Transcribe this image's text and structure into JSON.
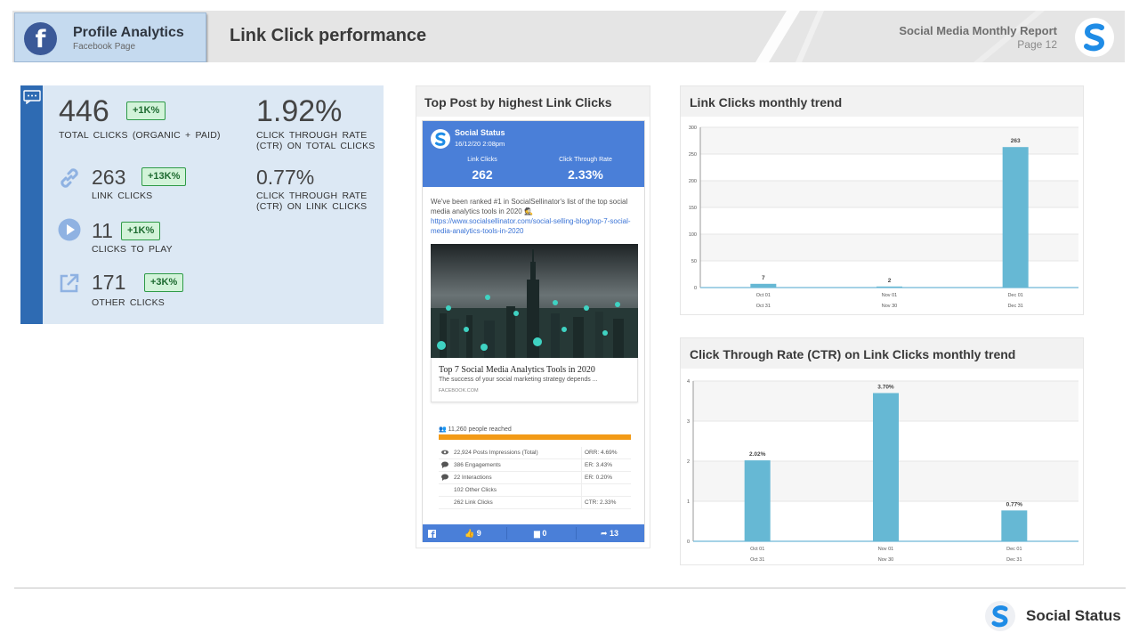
{
  "header": {
    "profile_title": "Profile Analytics",
    "profile_subtitle": "Facebook Page",
    "page_title": "Link Click performance",
    "report_title": "Social Media Monthly Report",
    "page_number": "Page 12",
    "facebook_letter": "f"
  },
  "kpis": {
    "total_clicks": {
      "value": "446",
      "badge": "+1K%",
      "label": "TOTAL CLICKS  (ORGANIC + PAID)"
    },
    "ctr_total": {
      "value": "1.92%",
      "label_line1": "CLICK THROUGH  RATE",
      "label_line2": "(CTR) ON TOTAL CLICKS"
    },
    "link_clicks": {
      "value": "263",
      "badge": "+13K%",
      "label": "LINK  CLICKS"
    },
    "ctr_link": {
      "value": "0.77%",
      "label_line1": "CLICK THROUGH  RATE",
      "label_line2": "(CTR) ON LINK CLICKS"
    },
    "clicks_to_play": {
      "value": "11",
      "badge": "+1K%",
      "label": "CLICKS  TO PLAY"
    },
    "other_clicks": {
      "value": "171",
      "badge": "+3K%",
      "label": "OTHER  CLICKS"
    }
  },
  "top_post": {
    "card_title": "Top Post by  highest Link Clicks",
    "account_name": "Social Status",
    "date": "16/12/20 2:08pm",
    "stat1_label": "Link Clicks",
    "stat1_value": "262",
    "stat2_label": "Click Through Rate",
    "stat2_value": "2.33%",
    "text": "We've been ranked #1 in SocialSellinator's list of the top social media analytics tools in 2020 🕵",
    "link": "https://www.socialsellinator.com/social-selling-blog/top-7-social-media-analytics-tools-in-2020",
    "link_title": "Top 7 Social Media Analytics Tools in 2020",
    "link_desc": "The success of your social marketing strategy depends ...",
    "link_source": "FACEBOOK.COM",
    "reach": "11,260 people reached",
    "reach_fill": 1.0,
    "metrics": [
      {
        "icon": "eye-icon",
        "label": "22,924 Posts Impressions (Total)",
        "value": "ORR: 4.69%"
      },
      {
        "icon": "comment-icon",
        "label": "386 Engagements",
        "value": "ER: 3.43%"
      },
      {
        "icon": "comment-icon",
        "label": "22 Interactions",
        "value": "ER: 0.20%"
      },
      {
        "icon": "",
        "label": "102 Other Clicks",
        "value": ""
      },
      {
        "icon": "",
        "label": "262 Link Clicks",
        "value": "CTR: 2.33%"
      }
    ],
    "likes": "9",
    "comments": "0",
    "shares": "13"
  },
  "chart_data": [
    {
      "type": "bar",
      "title": "Link Clicks monthly trend",
      "categories": [
        "Oct 01 | Oct 31",
        "Nov 01 | Nov 30",
        "Dec 01 | Dec 31"
      ],
      "category_line1": [
        "Oct 01",
        "Nov 01",
        "Dec 01"
      ],
      "category_line2": [
        "Oct 31",
        "Nov 30",
        "Dec 31"
      ],
      "values": [
        7,
        2,
        263
      ],
      "data_labels": [
        "7",
        "2",
        "263"
      ],
      "ylim": [
        0,
        300
      ],
      "yticks": [
        0,
        50,
        100,
        150,
        200,
        250,
        300
      ],
      "grid": true,
      "color": "#66b8d4"
    },
    {
      "type": "bar",
      "title": "Click Through Rate (CTR) on Link Clicks monthly trend",
      "categories": [
        "Oct 01 | Oct 31",
        "Nov 01 | Nov 30",
        "Dec 01 | Dec 31"
      ],
      "category_line1": [
        "Oct 01",
        "Nov 01",
        "Dec 01"
      ],
      "category_line2": [
        "Oct 31",
        "Nov 30",
        "Dec 31"
      ],
      "values": [
        2.02,
        3.7,
        0.77
      ],
      "data_labels": [
        "2.02%",
        "3.70%",
        "0.77%"
      ],
      "ylim": [
        0,
        4
      ],
      "yticks": [
        0,
        1,
        2,
        3,
        4
      ],
      "grid": true,
      "color": "#66b8d4"
    }
  ],
  "footer": {
    "brand": "Social Status"
  },
  "colors": {
    "accent": "#2e6bb3",
    "kpi_bg": "#dce8f4",
    "badge_bg": "#d2f3d9",
    "post_blue": "#4a7fd8",
    "bar": "#66b8d4"
  }
}
